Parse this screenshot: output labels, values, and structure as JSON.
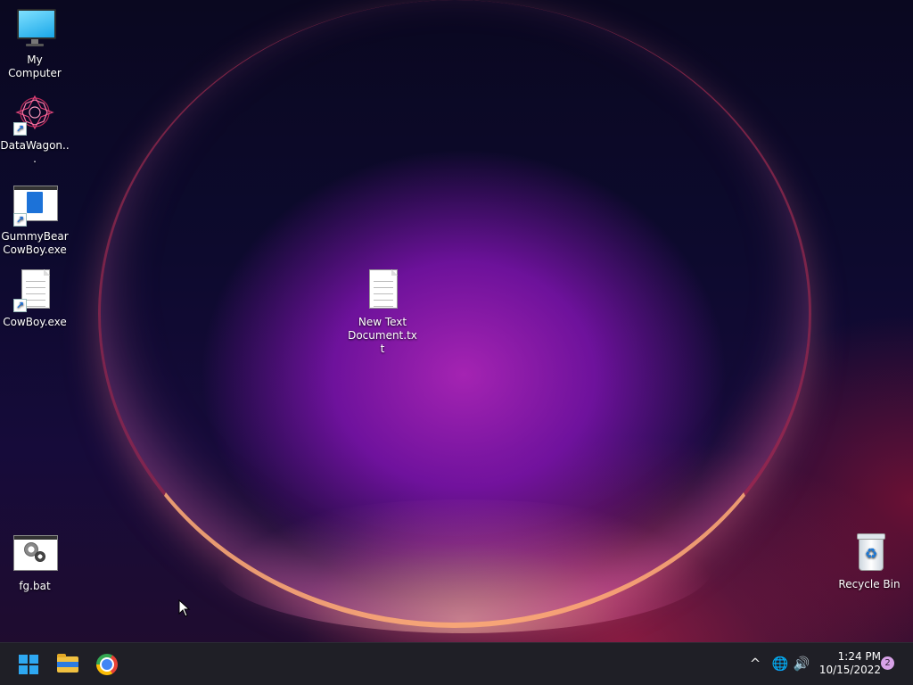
{
  "desktop": {
    "icons": [
      {
        "label": "My Computer",
        "icon": "monitor-icon"
      },
      {
        "label": "DataWagon...",
        "icon": "fractal-app-icon",
        "shortcut": true
      },
      {
        "label": "GummyBearCowBoy.exe",
        "icon": "window-app-icon",
        "shortcut": true
      },
      {
        "label": "CowBoy.exe",
        "icon": "document-icon",
        "shortcut": true
      },
      {
        "label": "New Text Document.txt",
        "icon": "document-icon"
      },
      {
        "label": "fg.bat",
        "icon": "batch-gear-icon"
      },
      {
        "label": "Recycle Bin",
        "icon": "recycle-bin-icon"
      }
    ]
  },
  "taskbar": {
    "start": {
      "icon": "windows-start-icon"
    },
    "pinned": [
      {
        "name": "File Explorer",
        "icon": "folder-icon"
      },
      {
        "name": "Google Chrome",
        "icon": "chrome-icon"
      }
    ],
    "tray": {
      "chevron": "^",
      "network": "🌐",
      "volume": "🔊"
    },
    "clock": {
      "time": "1:24 PM",
      "date": "10/15/2022"
    },
    "notifications_count": "2"
  },
  "colors": {
    "taskbar_bg": "#1f1f26",
    "accent": "#2ea8f2"
  }
}
